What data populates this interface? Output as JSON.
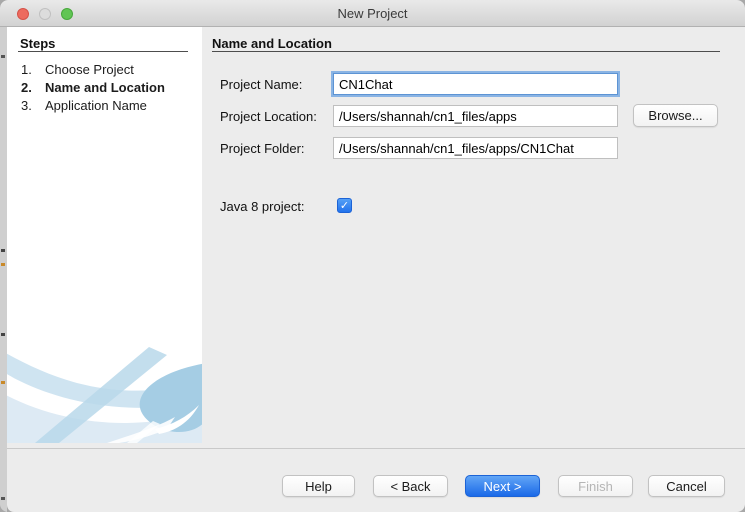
{
  "window": {
    "title": "New Project",
    "traffic_lights": {
      "close_color": "#ed6a5e",
      "minimize_color": "#dcdcdc",
      "zoom_color": "#61c554"
    }
  },
  "sidebar": {
    "heading": "Steps",
    "items": [
      {
        "num": "1.",
        "label": "Choose Project",
        "active": false
      },
      {
        "num": "2.",
        "label": "Name and Location",
        "active": true
      },
      {
        "num": "3.",
        "label": "Application Name",
        "active": false
      }
    ]
  },
  "content": {
    "heading": "Name and Location",
    "project_name": {
      "label": "Project Name:",
      "value": "CN1Chat",
      "focused": true
    },
    "project_location": {
      "label": "Project Location:",
      "value": "/Users/shannah/cn1_files/apps",
      "browse_label": "Browse..."
    },
    "project_folder": {
      "label": "Project Folder:",
      "value": "/Users/shannah/cn1_files/apps/CN1Chat"
    },
    "java8": {
      "label": "Java 8 project:",
      "checked": true,
      "check_glyph": "✓"
    }
  },
  "footer": {
    "help_label": "Help",
    "back_label": "< Back",
    "next_label": "Next >",
    "finish_label": "Finish",
    "cancel_label": "Cancel"
  },
  "colors": {
    "accent_blue": "#2272ec",
    "focus_ring": "#8ab4e4",
    "content_background": "#ececec",
    "swoosh_blue": "#b9d8ea"
  }
}
